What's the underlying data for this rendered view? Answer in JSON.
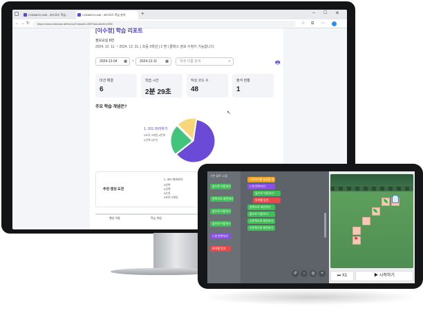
{
  "browser": {
    "tabs": [
      "CODMOS LMS - 코드모스 학습...",
      "CODMOS LMS - 코드모스 학습 분석"
    ],
    "url": "https://www.edubase.ai/lms/cpl?classId=2897&studentId=956"
  },
  "report": {
    "title": "[이수정] 학습 리포트",
    "section": "정보교실 8반",
    "period": "2024. 12. 11. ~ 2024. 12. 31. | 초등 3학년 | 2 명 | 클래스 정보 수정이 가능합니다.",
    "date_start": "2024-12-04",
    "date_sep": "~",
    "date_end": "2024-12-11",
    "search_placeholder": "학생 이름 검색",
    "stats": [
      {
        "label": "미션 해결",
        "value": "6"
      },
      {
        "label": "학습 시간",
        "value": "2분 29초"
      },
      {
        "label": "작성 코드 수",
        "value": "48"
      },
      {
        "label": "출석 현황",
        "value": "1"
      }
    ],
    "concept_question": "주요 학습 개념은?",
    "pie": {
      "legend_title": "1. 코드 따라하기",
      "legend_lines": [
        "#프로그래밍 #반복",
        "#선택 #순차"
      ],
      "slices": [
        {
          "value": 62,
          "color": "#6a4ad6"
        },
        {
          "value": 23,
          "color": "#43c47c"
        },
        {
          "value": 15,
          "color": "#f7d77a"
        }
      ]
    },
    "recommend_label": "추천 행성 도전",
    "recommend_title": "1. 코드 따라하기",
    "recommend_tags": [
      "#반복",
      "#선택",
      "#순차",
      "#프로그래밍"
    ],
    "table_headers": [
      "행성 이름",
      "학습 개념"
    ]
  },
  "game": {
    "palette_header": "기본 블록 11월",
    "palette_blocks": [
      {
        "label": "앞으로 이동하기",
        "color": "g"
      },
      {
        "label": "왼쪽으로 회전하기",
        "color": "g"
      },
      {
        "label": "앞으로 이동하기",
        "color": "g"
      },
      {
        "label": "앞으로 이동하기",
        "color": "g"
      },
      {
        "label": "2 번 반복하기",
        "color": "p"
      },
      {
        "label": "아이템 얻기",
        "color": "r"
      }
    ],
    "script_blocks": [
      {
        "label": "시작하기를 눌렀을 때",
        "color": "o",
        "indent": 0
      },
      {
        "label": "2 번 반복하기",
        "color": "p",
        "indent": 0
      },
      {
        "label": "앞으로 이동하기",
        "color": "g",
        "indent": 1
      },
      {
        "label": "아이템 얻기",
        "color": "r",
        "indent": 1
      },
      {
        "label": "왼쪽으로 회전하기",
        "color": "g",
        "indent": 0
      },
      {
        "label": "앞으로 이동하기",
        "color": "g",
        "indent": 0
      },
      {
        "label": "오른쪽으로 회전하기",
        "color": "g",
        "indent": 0
      },
      {
        "label": "오른쪽으로 회전하기",
        "color": "g",
        "indent": 0
      }
    ],
    "speed_label": "X1",
    "start_label": "시작하기"
  }
}
